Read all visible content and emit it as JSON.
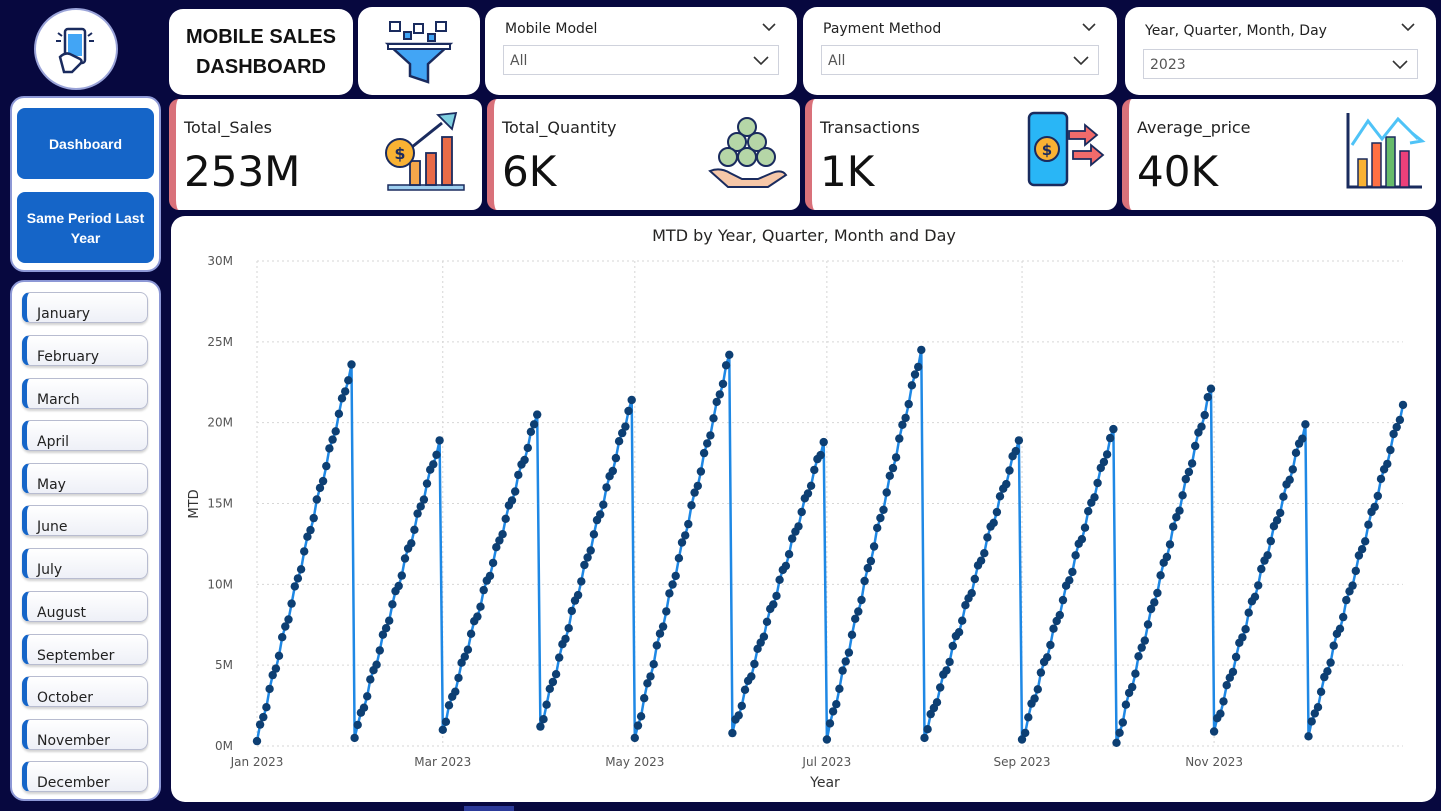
{
  "sidebar": {
    "logo_icon": "mobile-phone-hand-icon",
    "nav": [
      {
        "label": "Dashboard"
      },
      {
        "label": "Same Period Last Year"
      }
    ],
    "months": [
      "January",
      "February",
      "March",
      "April",
      "May",
      "June",
      "July",
      "August",
      "September",
      "October",
      "November",
      "December"
    ]
  },
  "header": {
    "title_line1": "MOBILE SALES",
    "title_line2": "DASHBOARD",
    "filter_icon": "funnel-icon"
  },
  "slicers": [
    {
      "label": "Mobile Model",
      "value": "All"
    },
    {
      "label": "Payment Method",
      "value": "All"
    },
    {
      "label": "Year, Quarter, Month, Day",
      "value": "2023"
    }
  ],
  "kpis": [
    {
      "label": "Total_Sales",
      "value": "253M",
      "icon": "sales-growth-icon"
    },
    {
      "label": "Total_Quantity",
      "value": "6K",
      "icon": "coins-stack-icon"
    },
    {
      "label": "Transactions",
      "value": "1K",
      "icon": "mobile-payment-icon"
    },
    {
      "label": "Average_price",
      "value": "40K",
      "icon": "bar-chart-icon"
    }
  ],
  "colors": {
    "background": "#07083f",
    "accent": "#1565c8",
    "kpi_accent": "#d9717a",
    "line": "#1e88e5",
    "marker": "#0d3f73"
  },
  "chart_data": {
    "type": "line",
    "title": "MTD by Year, Quarter, Month and Day",
    "xlabel": "Year",
    "ylabel": "MTD",
    "ylim": [
      0,
      30
    ],
    "yunit": "M",
    "ytick_labels": [
      "0M",
      "5M",
      "10M",
      "15M",
      "20M",
      "25M",
      "30M"
    ],
    "xtick_labels": [
      "Jan 2023",
      "Mar 2023",
      "May 2023",
      "Jul 2023",
      "Sep 2023",
      "Nov 2023"
    ],
    "grid": true,
    "series": [
      {
        "months": [
          {
            "month": "2023-01",
            "days": 31,
            "start": 0.3,
            "end": 23.6
          },
          {
            "month": "2023-02",
            "days": 28,
            "start": 0.5,
            "end": 18.9
          },
          {
            "month": "2023-03",
            "days": 31,
            "start": 1.0,
            "end": 20.5
          },
          {
            "month": "2023-04",
            "days": 30,
            "start": 1.2,
            "end": 21.4
          },
          {
            "month": "2023-05",
            "days": 31,
            "start": 0.5,
            "end": 24.2
          },
          {
            "month": "2023-06",
            "days": 30,
            "start": 0.8,
            "end": 18.8
          },
          {
            "month": "2023-07",
            "days": 31,
            "start": 0.4,
            "end": 24.5
          },
          {
            "month": "2023-08",
            "days": 31,
            "start": 0.5,
            "end": 18.9
          },
          {
            "month": "2023-09",
            "days": 30,
            "start": 0.4,
            "end": 19.6
          },
          {
            "month": "2023-10",
            "days": 31,
            "start": 0.2,
            "end": 22.1
          },
          {
            "month": "2023-11",
            "days": 30,
            "start": 0.9,
            "end": 19.9
          },
          {
            "month": "2023-12",
            "days": 31,
            "start": 0.6,
            "end": 21.1
          }
        ]
      }
    ]
  }
}
